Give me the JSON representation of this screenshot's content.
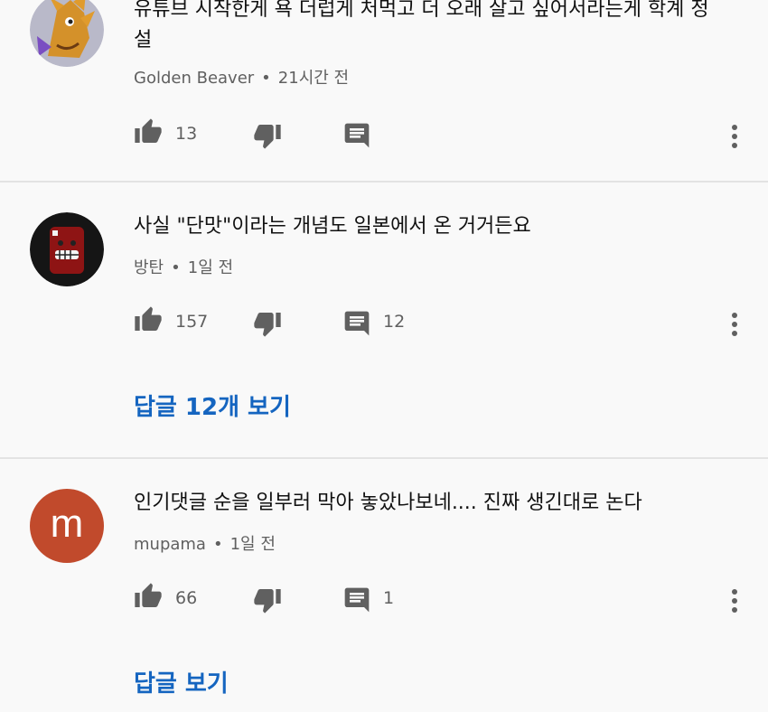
{
  "comments": [
    {
      "text": "유튜브 시작한게 욕 더럽게 처먹고 더 오래 살고 싶어서라는게 학계 정설",
      "author": "Golden Beaver",
      "time": "21시간 전",
      "likes": "13",
      "reply_count": "",
      "avatar_color": "#b8b8c8"
    },
    {
      "text": "사실 \"단맛\"이라는 개념도 일본에서 온 거거든요",
      "author": "방탄",
      "time": "1일 전",
      "likes": "157",
      "reply_count": "12",
      "view_replies": "답글 12개 보기",
      "avatar_color": "#1a1a1a"
    },
    {
      "text": "인기댓글 순을 일부러 막아 놓았나보네.... 진짜 생긴대로 논다",
      "author": "mupama",
      "time": "1일 전",
      "likes": "66",
      "reply_count": "1",
      "view_replies": "답글 보기",
      "avatar_letter": "m",
      "avatar_color": "#c14a2c"
    }
  ],
  "colors": {
    "background": "#f9f9f9",
    "link": "#1565c0",
    "icon": "#606060",
    "divider": "#e3e3e3"
  },
  "icons": [
    "thumbs-up-icon",
    "thumbs-down-icon",
    "reply-icon",
    "more-vert-icon"
  ]
}
